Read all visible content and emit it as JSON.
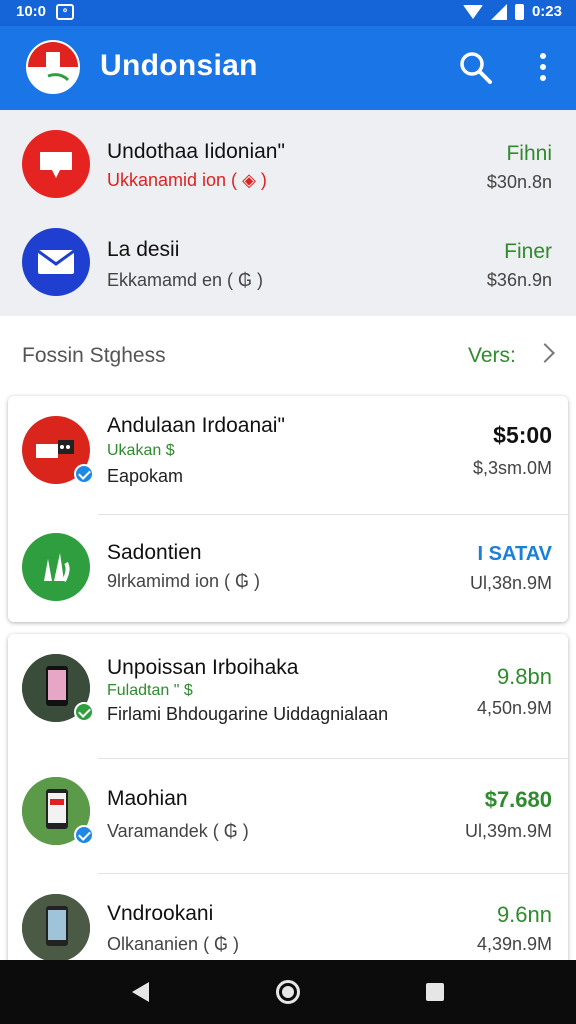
{
  "status_bar": {
    "time_left": "10:0",
    "time_right": "0:23"
  },
  "app_bar": {
    "title": "Undonsian",
    "search_icon": "search-icon",
    "menu_icon": "more-vert-icon",
    "logo": "flag-logo"
  },
  "top_list": [
    {
      "name": "Undothaa Iidonian\"",
      "sub": "Ukkanamid ion (",
      "right_top": "Fihni",
      "right_bottom": "$30n.8n",
      "icon": "chat-bubble-icon",
      "colors": {
        "avatar": "#e52421"
      }
    },
    {
      "name": "La desii",
      "sub": "Ekkamamd en ( ₲ )",
      "right_top": "Finer",
      "right_bottom": "$36n.9n",
      "icon": "mail-icon",
      "colors": {
        "avatar": "#1e3fd0"
      }
    }
  ],
  "section": {
    "title": "Fossin Stghess",
    "link": "Vers:"
  },
  "card1": [
    {
      "name": "Andulaan Irdoanai\"",
      "sub1": "Ukakan $",
      "sub2": "Eapokam",
      "right_top": "$5:00",
      "right_bottom": "$,3sm.0M",
      "icon": "tag-icon",
      "colors": {
        "avatar": "#d9251c"
      }
    },
    {
      "name": "Sadontien",
      "sub1": "9lrkamimd ion ( ₲ )",
      "right_top": "I SATAV",
      "right_bottom": "Ul,38n.9M",
      "icon": "leaf-icon",
      "colors": {
        "avatar": "#2e9e3e"
      }
    }
  ],
  "card2": [
    {
      "name": "Unpoissan Irboihaka",
      "sub1": "Fuladtan \" $",
      "sub2": "Firlami Bhdougarine Uiddagnialaan",
      "right_top": "9.8bn",
      "right_bottom": "4,50n.9M",
      "icon": "phone-photo"
    },
    {
      "name": "Maohian",
      "sub1": "Varamandek ( ₲ )",
      "right_top": "$7.680",
      "right_bottom": "Ul,39m.9M",
      "icon": "phone-photo"
    },
    {
      "name": "Vndrookani",
      "sub1": "Olkananien ( ₲ )",
      "right_top": "9.6nn",
      "right_bottom": "4,39n.9M",
      "icon": "phone-photo"
    }
  ],
  "nav": {
    "back_icon": "back-icon",
    "home_icon": "home-icon",
    "recent_icon": "recent-apps-icon"
  }
}
